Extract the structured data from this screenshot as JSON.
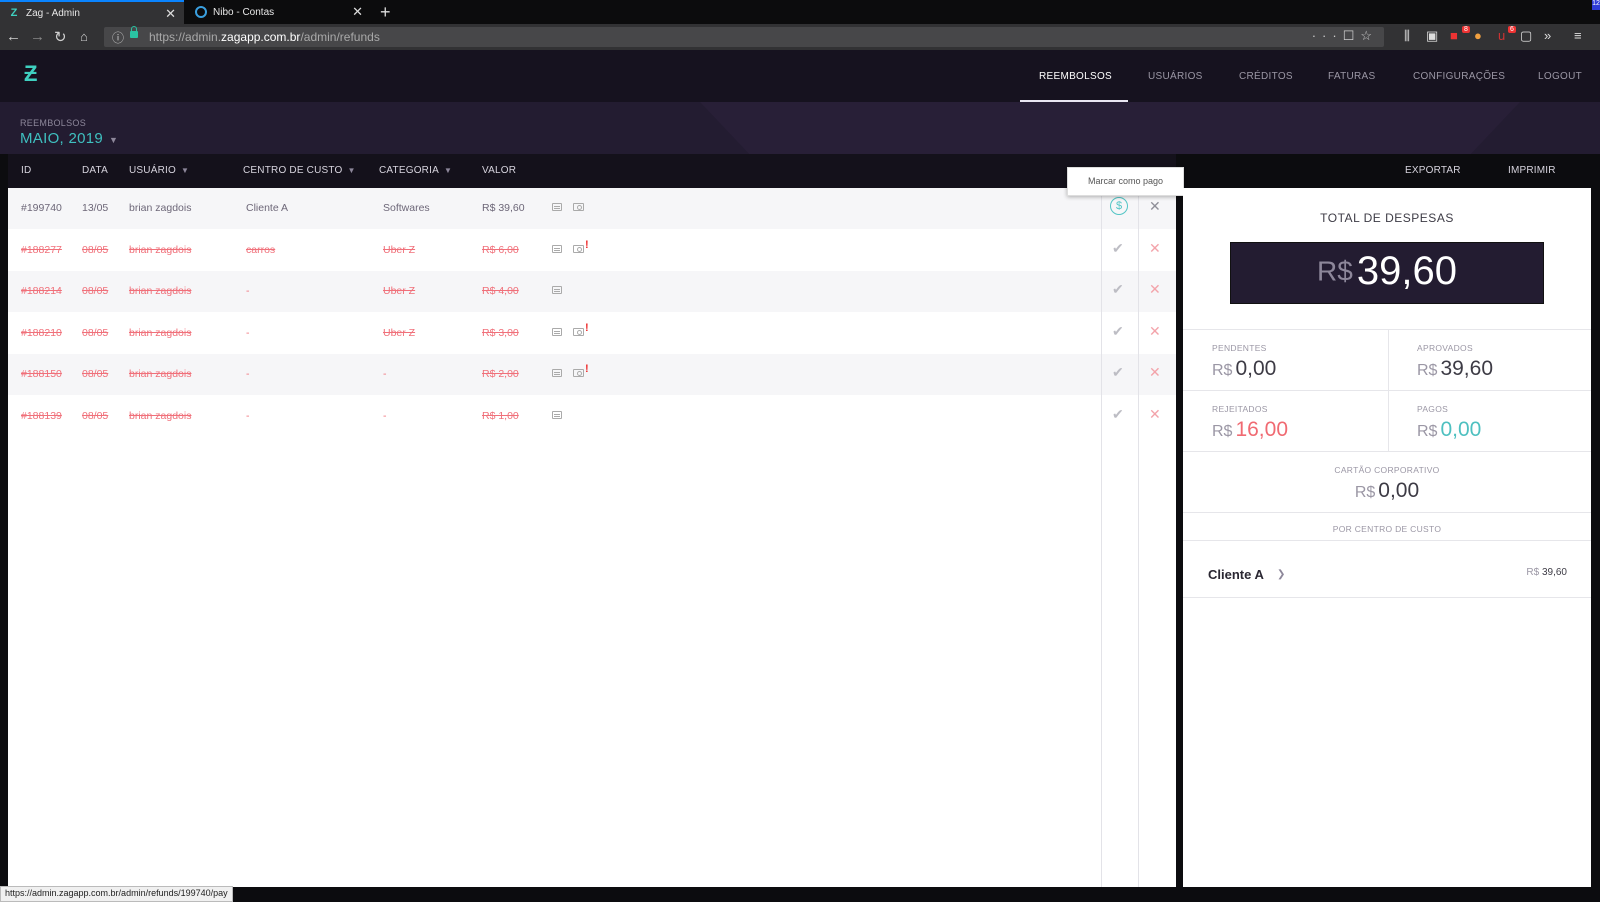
{
  "browser": {
    "tabs": [
      {
        "title": "Zag - Admin",
        "icon": "zag-icon",
        "active": true
      },
      {
        "title": "Nibo - Contas",
        "icon": "nibo-icon",
        "active": false
      }
    ],
    "url_prefix": "https://admin.",
    "url_domain": "zagapp.com.br",
    "url_path": "/admin/refunds",
    "badges": {
      "ext1": "8",
      "ext2": "6"
    },
    "corner": "12",
    "status_url": "https://admin.zagapp.com.br/admin/refunds/199740/pay"
  },
  "nav": {
    "items": [
      "REEMBOLSOS",
      "USUÁRIOS",
      "CRÉDITOS",
      "FATURAS",
      "CONFIGURAÇÕES",
      "LOGOUT"
    ],
    "active": "REEMBOLSOS"
  },
  "page": {
    "breadcrumb": "REEMBOLSOS",
    "month": "MAIO, 2019"
  },
  "table": {
    "headers": {
      "id": "ID",
      "data": "DATA",
      "usuario": "USUÁRIO",
      "centro": "CENTRO DE CUSTO",
      "categoria": "CATEGORIA",
      "valor": "VALOR"
    },
    "export_label": "EXPORTAR",
    "print_label": "IMPRIMIR",
    "tooltip": "Marcar como pago",
    "rows": [
      {
        "id": "#199740",
        "data": "13/05",
        "usuario": "brian zagdois",
        "centro": "Cliente A",
        "categoria": "Softwares",
        "valor": "R$ 39,60",
        "status": "approved",
        "receipt": true,
        "alert": false
      },
      {
        "id": "#188277",
        "data": "08/05",
        "usuario": "brian zagdois",
        "centro": "carros",
        "categoria": "Uber Z",
        "valor": "R$ 6,00",
        "status": "rejected",
        "receipt": true,
        "alert": true
      },
      {
        "id": "#188214",
        "data": "08/05",
        "usuario": "brian zagdois",
        "centro": "-",
        "categoria": "Uber Z",
        "valor": "R$ 4,00",
        "status": "rejected",
        "receipt": false,
        "alert": false
      },
      {
        "id": "#188210",
        "data": "08/05",
        "usuario": "brian zagdois",
        "centro": "-",
        "categoria": "Uber Z",
        "valor": "R$ 3,00",
        "status": "rejected",
        "receipt": true,
        "alert": true
      },
      {
        "id": "#188150",
        "data": "08/05",
        "usuario": "brian zagdois",
        "centro": "-",
        "categoria": "-",
        "valor": "R$ 2,00",
        "status": "rejected",
        "receipt": true,
        "alert": true
      },
      {
        "id": "#188139",
        "data": "08/05",
        "usuario": "brian zagdois",
        "centro": "-",
        "categoria": "-",
        "valor": "R$ 1,00",
        "status": "rejected",
        "receipt": false,
        "alert": false
      }
    ]
  },
  "summary": {
    "title": "TOTAL DE DESPESAS",
    "currency": "R$",
    "total": "39,60",
    "pendentes_label": "PENDENTES",
    "pendentes": "0,00",
    "aprovados_label": "APROVADOS",
    "aprovados": "39,60",
    "rejeitados_label": "REJEITADOS",
    "rejeitados": "16,00",
    "pagos_label": "PAGOS",
    "pagos": "0,00",
    "cartao_label": "CARTÃO CORPORATIVO",
    "cartao": "0,00",
    "por_centro_label": "POR CENTRO DE CUSTO",
    "centros": [
      {
        "name": "Cliente A",
        "value": "39,60"
      }
    ]
  },
  "colors": {
    "accent_teal": "#3fc0c0",
    "rejected_red": "#f0707a",
    "header_dark": "#16121f",
    "box_dark": "#231c31"
  }
}
